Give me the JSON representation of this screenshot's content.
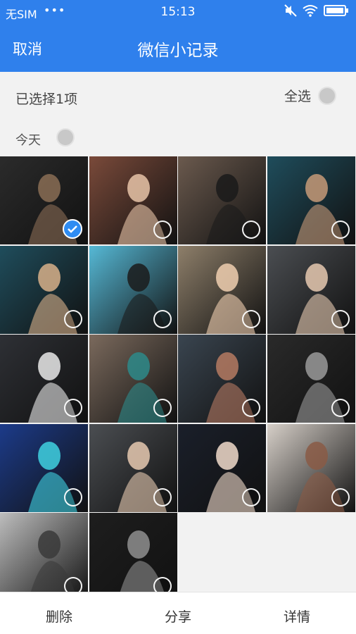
{
  "status_bar": {
    "carrier": "无SIM",
    "dots": "•••",
    "time": "15:13"
  },
  "nav": {
    "cancel_label": "取消",
    "title": "微信小记录"
  },
  "selection": {
    "count_text": "已选择1项",
    "select_all_label": "全选"
  },
  "date_group": {
    "label": "今天"
  },
  "photos": [
    {
      "name": "photo-1",
      "selected": true,
      "bg": "#2b2b2b",
      "fg": "#8a6d55"
    },
    {
      "name": "photo-2",
      "selected": false,
      "bg": "#7a4a3a",
      "fg": "#e7c4a8"
    },
    {
      "name": "photo-3",
      "selected": false,
      "bg": "#6b5a4e",
      "fg": "#1a1a1a"
    },
    {
      "name": "photo-4",
      "selected": false,
      "bg": "#1f4d5c",
      "fg": "#c79a78"
    },
    {
      "name": "photo-5",
      "selected": false,
      "bg": "#1f4d5c",
      "fg": "#d8b08a"
    },
    {
      "name": "photo-6",
      "selected": false,
      "bg": "#56b9d6",
      "fg": "#1b1b1b"
    },
    {
      "name": "photo-7",
      "selected": false,
      "bg": "#8e7f6a",
      "fg": "#f0cfb0"
    },
    {
      "name": "photo-8",
      "selected": false,
      "bg": "#4b4e52",
      "fg": "#e6c9b0"
    },
    {
      "name": "photo-9",
      "selected": false,
      "bg": "#2e3035",
      "fg": "#e9e9e9"
    },
    {
      "name": "photo-10",
      "selected": false,
      "bg": "#7b6a5d",
      "fg": "#2d8a8a"
    },
    {
      "name": "photo-11",
      "selected": false,
      "bg": "#3a4550",
      "fg": "#b57a62"
    },
    {
      "name": "photo-12",
      "selected": false,
      "bg": "#2a2a2a",
      "fg": "#9a9a9a"
    },
    {
      "name": "photo-13",
      "selected": false,
      "bg": "#1c3b8a",
      "fg": "#3fd1e0"
    },
    {
      "name": "photo-14",
      "selected": false,
      "bg": "#4b4e52",
      "fg": "#e6c9b0"
    },
    {
      "name": "photo-15",
      "selected": false,
      "bg": "#1a1f2a",
      "fg": "#f1dccb"
    },
    {
      "name": "photo-16",
      "selected": false,
      "bg": "#d6cfc8",
      "fg": "#8a5a45"
    },
    {
      "name": "photo-17",
      "selected": false,
      "bg": "#bdbdbd",
      "fg": "#3a3a3a"
    },
    {
      "name": "photo-18",
      "selected": false,
      "bg": "#1e1e1e",
      "fg": "#8f8f8f"
    }
  ],
  "bottom_bar": {
    "delete_label": "删除",
    "share_label": "分享",
    "details_label": "详情"
  },
  "colors": {
    "primary": "#2f80ec",
    "check": "#2f8cf2"
  }
}
